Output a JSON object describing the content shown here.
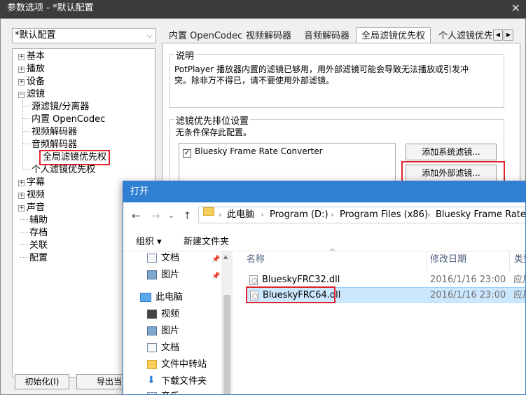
{
  "window": {
    "title": "参数选项 - *默认配置",
    "close_glyph": "✕"
  },
  "preset": {
    "value": "*默认配置",
    "chevron": "⌵"
  },
  "tree": {
    "items": [
      {
        "label": "基本",
        "expander": "+"
      },
      {
        "label": "播放",
        "expander": "+"
      },
      {
        "label": "设备",
        "expander": "+"
      },
      {
        "label": "滤镜",
        "expander": "−"
      },
      {
        "label": "源滤镜/分离器"
      },
      {
        "label": "内置 OpenCodec"
      },
      {
        "label": "视频解码器"
      },
      {
        "label": "音频解码器"
      },
      {
        "label": "全局滤镜优先权"
      },
      {
        "label": "个人滤镜优先权"
      },
      {
        "label": "字幕",
        "expander": "+"
      },
      {
        "label": "视频",
        "expander": "+"
      },
      {
        "label": "声音",
        "expander": "+"
      },
      {
        "label": "辅助"
      },
      {
        "label": "存档"
      },
      {
        "label": "关联"
      },
      {
        "label": "配置"
      }
    ]
  },
  "bottom_buttons": {
    "init": "初始化(I)",
    "export": "导出当"
  },
  "tabs": [
    {
      "label": "内置 OpenCodec"
    },
    {
      "label": "视频解码器"
    },
    {
      "label": "音频解码器"
    },
    {
      "label": "全局滤镜优先权",
      "active": true
    },
    {
      "label": "个人滤镜优先"
    }
  ],
  "tab_scroll": {
    "left": "◀",
    "right": "▶"
  },
  "description": {
    "title": "说明",
    "text_line1": "PotPlayer 播放器内置的滤镜已够用，用外部滤镜可能会导致无法播放或引发冲",
    "text_line2": "突。除非万不得已，请不要使用外部滤镜。"
  },
  "priority": {
    "title": "滤镜优先排位设置",
    "subtitle": "无条件保存此配置。",
    "filters": [
      {
        "label": "Bluesky Frame Rate Converter",
        "checked": true,
        "check_glyph": "✓"
      }
    ],
    "add_system_button": "添加系统滤镜...",
    "add_external_button": "添加外部滤镜..."
  },
  "dialog": {
    "title": "打开",
    "nav": {
      "back": "←",
      "forward": "→",
      "dropdown": "⌄",
      "up": "↑"
    },
    "breadcrumb": [
      "此电脑",
      "Program (D:)",
      "Program Files (x86)",
      "Bluesky Frame Rate Co"
    ],
    "breadcrumb_sep": "›",
    "toolbar": {
      "organize": "组织 ▾",
      "new_folder": "新建文件夹"
    },
    "sidebar": [
      {
        "label": "文档",
        "icon": "document-icon",
        "pinned": true
      },
      {
        "label": "图片",
        "icon": "pictures-icon",
        "pinned": true
      },
      {
        "label": "此电脑",
        "icon": "computer-icon"
      },
      {
        "label": "视频",
        "icon": "videos-icon"
      },
      {
        "label": "图片",
        "icon": "pictures-icon"
      },
      {
        "label": "文档",
        "icon": "document-icon"
      },
      {
        "label": "文件中转站",
        "icon": "folder-icon"
      },
      {
        "label": "下载文件夹",
        "icon": "download-icon"
      },
      {
        "label": "音乐",
        "icon": "music-icon"
      }
    ],
    "pin_glyph": "📌",
    "scroll_up": "▲",
    "columns": {
      "name": "名称",
      "date": "修改日期",
      "type": "类型"
    },
    "sort_glyph": "^",
    "files": [
      {
        "name": "BlueskyFRC32.dll",
        "date": "2016/1/16 23:00",
        "type": "应用"
      },
      {
        "name": "BlueskyFRC64.dll",
        "date": "2016/1/16 23:00",
        "type": "应用",
        "selected": true
      }
    ]
  },
  "colors": {
    "highlight_red": "#e0242b",
    "dialog_blue": "#2f7fd3",
    "selection": "#cce8ff"
  }
}
